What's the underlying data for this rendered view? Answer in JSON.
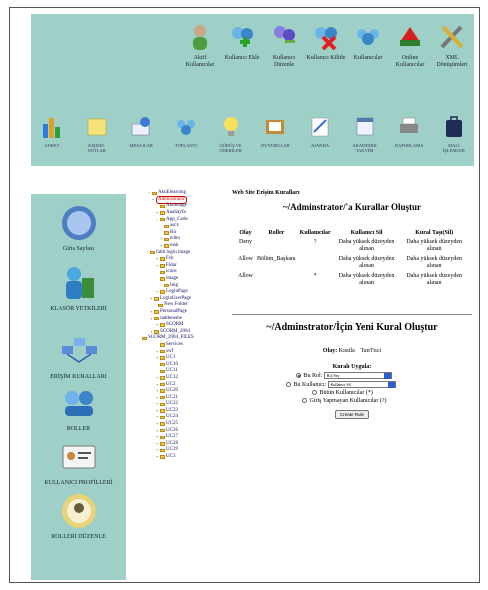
{
  "toolbar_top": [
    {
      "label": "Aktif Kullanıcılar",
      "icon": "active-users-icon"
    },
    {
      "label": "Kullanıcı Ekle",
      "icon": "add-user-icon"
    },
    {
      "label": "Kullanıcı Düzenle",
      "icon": "edit-user-icon"
    },
    {
      "label": "Kullanıcı Kilitle",
      "icon": "lock-user-icon"
    },
    {
      "label": "Kullanıcılar",
      "icon": "users-icon"
    },
    {
      "label": "Online Kullanıcılar",
      "icon": "online-users-icon"
    },
    {
      "label": "XML Dönüşümleri",
      "icon": "xml-tools-icon"
    }
  ],
  "toolbar_bottom": [
    {
      "label": "ANKET",
      "icon": "chart-icon"
    },
    {
      "label": "KİŞİSEL NOTLAR",
      "icon": "notes-icon"
    },
    {
      "label": "MESAJLAR",
      "icon": "messages-icon"
    },
    {
      "label": "TOPLANTI",
      "icon": "meeting-icon"
    },
    {
      "label": "GÖRÜŞ VE ÖNERİLER",
      "icon": "idea-icon"
    },
    {
      "label": "DUYURULAR",
      "icon": "announcement-icon"
    },
    {
      "label": "AJANDA",
      "icon": "agenda-icon"
    },
    {
      "label": "AKADEMİK TAKVİM",
      "icon": "calendar-icon"
    },
    {
      "label": "RAPORLAMA",
      "icon": "printer-icon"
    },
    {
      "label": "MALİ İŞLEMLER",
      "icon": "finance-icon"
    }
  ],
  "sidebar": [
    {
      "label": "Giris Sayfası",
      "icon": "home-icon"
    },
    {
      "label": "KLASÖR YETKİLERİ",
      "icon": "folder-permissions-icon"
    },
    {
      "label": "ERİŞİM KURALLARI",
      "icon": "network-icon"
    },
    {
      "label": "ROLLER",
      "icon": "roles-icon"
    },
    {
      "label": "KULLANICI PROFİLLERİ",
      "icon": "profile-card-icon"
    },
    {
      "label": "ROLLERİ DÜZENLE",
      "icon": "edit-roles-icon"
    }
  ],
  "tree": [
    "AkuElearning",
    "Adminstrator",
    "Akuimage",
    "AnaSayfa",
    "App_Code",
    "ascx",
    "Bir",
    "edito",
    "essk",
    "fatih login image",
    "Fck",
    "Fidar",
    "icons",
    "image",
    "Img",
    "LoginPage",
    "LoginUserPage",
    "New Folder",
    "PersonalPage",
    "raddeneme",
    "SCORM",
    "SCORM_2004",
    "SCORM_2004_FILES",
    "Services",
    "swf",
    "UC1",
    "UC10",
    "UC11",
    "UC12",
    "UC2",
    "UC20",
    "UC21",
    "UC22",
    "UC23",
    "UC24",
    "UC25",
    "UC26",
    "UC27",
    "UC28",
    "UC29",
    "UC3"
  ],
  "main": {
    "subtitle": "Web Site Erişim Kuralları",
    "title": "~/Adminstrator/'a Kurallar Oluştur",
    "headers": [
      "Olay",
      "Roller",
      "Kullanıcılar",
      "Kullanıcı Sil",
      "Kural Taşı(Sil)"
    ],
    "rows": [
      {
        "olay": "Deny",
        "roller": "",
        "kullanicilar": "?",
        "sil": "Daha yüksek düzeyden alınan",
        "tasi": "Daha yüksek düzeyden alınan"
      },
      {
        "olay": "Allow",
        "roller": "Bölüm_Başkanı",
        "kullanicilar": "",
        "sil": "Daha yüksek düzeyden alınan",
        "tasi": "Daha yüksek düzeyden alınan"
      },
      {
        "olay": "Allow",
        "roller": "",
        "kullanicilar": "*",
        "sil": "Daha yüksek düzeyden alınan",
        "tasi": "Daha yüksek düzeyden alınan"
      }
    ],
    "new_title": "~/Adminstrator/İçin Yeni Kural Oluştur",
    "olay_label": "Olay:",
    "kisitla": "Kısıtla",
    "tani": "Tan'i'tıci",
    "kural_label": "Kuralı Uygula:",
    "bu_rol": "Bu Rol:",
    "rol_sec": "Rol Seç",
    "bu_kullanici": "Bu Kullanıcı:",
    "kullanici_sec": "Kullanıcı Sil",
    "butun": "Bütün Kullanıcılar (*)",
    "giris": "Giriş Yapmayan Kullanıcılar (?)",
    "create_button": "Create Rule"
  }
}
